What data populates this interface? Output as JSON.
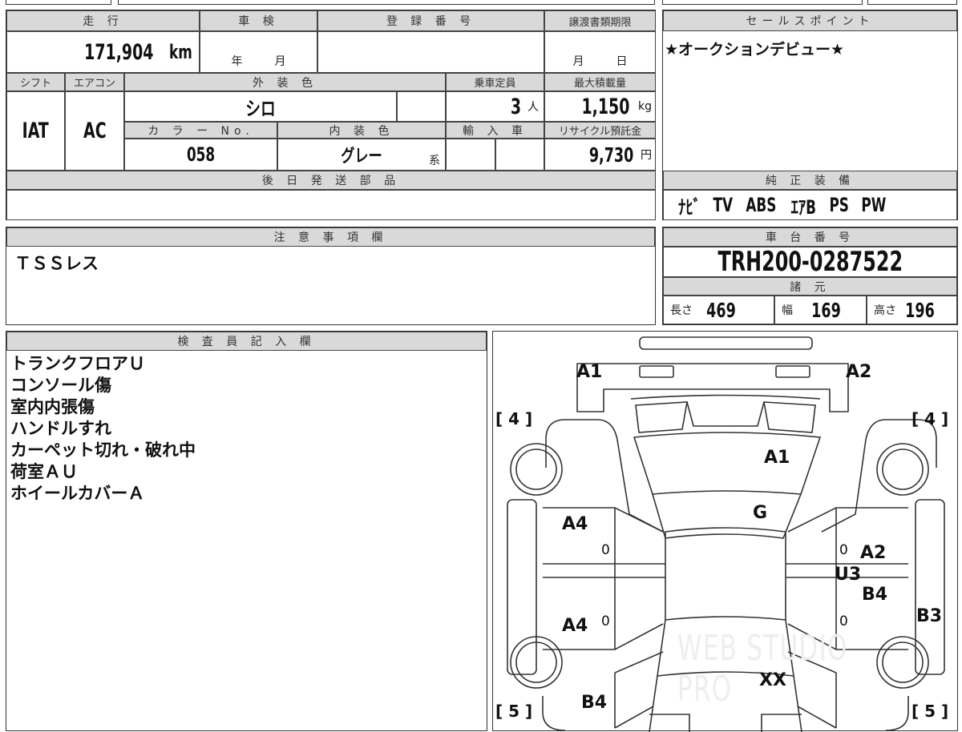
{
  "mileage": {
    "label": "走 行",
    "value": "171,904",
    "unit": "km"
  },
  "inspection": {
    "label": "車 検",
    "year_unit": "年",
    "month_unit": "月"
  },
  "registration": {
    "label": "登 録 番 号"
  },
  "transfer_deadline": {
    "label": "譲渡書類期限",
    "month_unit": "月",
    "day_unit": "日"
  },
  "shift": {
    "label": "シフト",
    "value": "IAT"
  },
  "aircon": {
    "label": "エアコン",
    "value": "AC"
  },
  "exterior_color": {
    "label": "外 装 色",
    "value": "シロ"
  },
  "capacity": {
    "label": "乗車定員",
    "value": "3",
    "unit": "人"
  },
  "max_load": {
    "label": "最大積載量",
    "value": "1,150",
    "unit": "kg"
  },
  "color_no": {
    "label": "カ ラ ー No.",
    "value": "058"
  },
  "interior_color": {
    "label": "内 装 色",
    "value": "グレー",
    "suffix": "系"
  },
  "imported": {
    "label": "輸 入 車"
  },
  "recycle_fee": {
    "label": "リサイクル預託金",
    "value": "9,730",
    "unit": "円"
  },
  "later_parts": {
    "label": "後 日 発 送 部 品"
  },
  "notes": {
    "label": "注 意 事 項 欄",
    "text": "ＴＳＳレス"
  },
  "sales_point": {
    "label": "セールスポイント",
    "text": "★オークションデビュー★"
  },
  "equipment": {
    "label": "純 正 装 備",
    "items": [
      "ﾅﾋﾞ",
      "TV",
      "ABS",
      "ｴｱB",
      "PS",
      "PW"
    ]
  },
  "chassis": {
    "label": "車 台 番 号",
    "value": "TRH200-0287522"
  },
  "specs": {
    "label": "諸 元",
    "length_label": "長さ",
    "length": "469",
    "width_label": "幅",
    "width": "169",
    "height_label": "高さ",
    "height": "196"
  },
  "inspector": {
    "label": "検 査 員 記 入 欄",
    "lines": [
      "トランクフロアＵ",
      "コンソール傷",
      "室内内張傷",
      "ハンドルすれ",
      "カーペット切れ・破れ中",
      "荷室ＡＵ",
      "ホイールカバーＡ"
    ]
  },
  "diagram": {
    "marks": [
      "A1",
      "A2",
      "A1",
      "G",
      "A4",
      "A4",
      "A2",
      "U3",
      "B4",
      "B3",
      "XX",
      "B4"
    ],
    "zeros": [
      "0",
      "0",
      "0",
      "0"
    ],
    "tires": [
      "[ 4 ]",
      "[ 4 ]",
      "[ 5 ]",
      "[ 5 ]"
    ],
    "watermark": "WEB STUDIO PRO"
  }
}
